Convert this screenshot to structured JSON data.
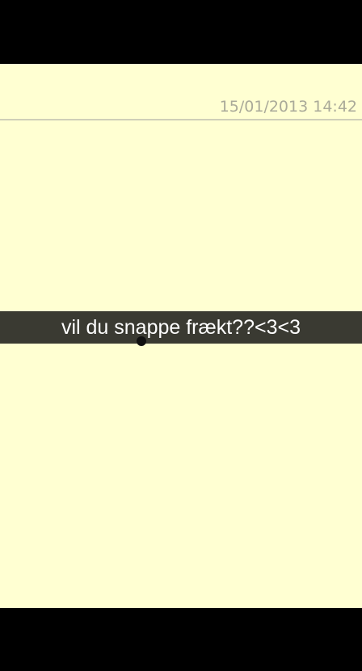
{
  "note": {
    "timestamp": "15/01/2013 14:42",
    "caption": "vil du snappe frækt??<3<3"
  },
  "colors": {
    "background": "#FFFFD2",
    "timestamp": "#AAAA99",
    "caption_bar": "#3A3A32",
    "caption_text": "#FFFFFF",
    "frame": "#000000"
  }
}
